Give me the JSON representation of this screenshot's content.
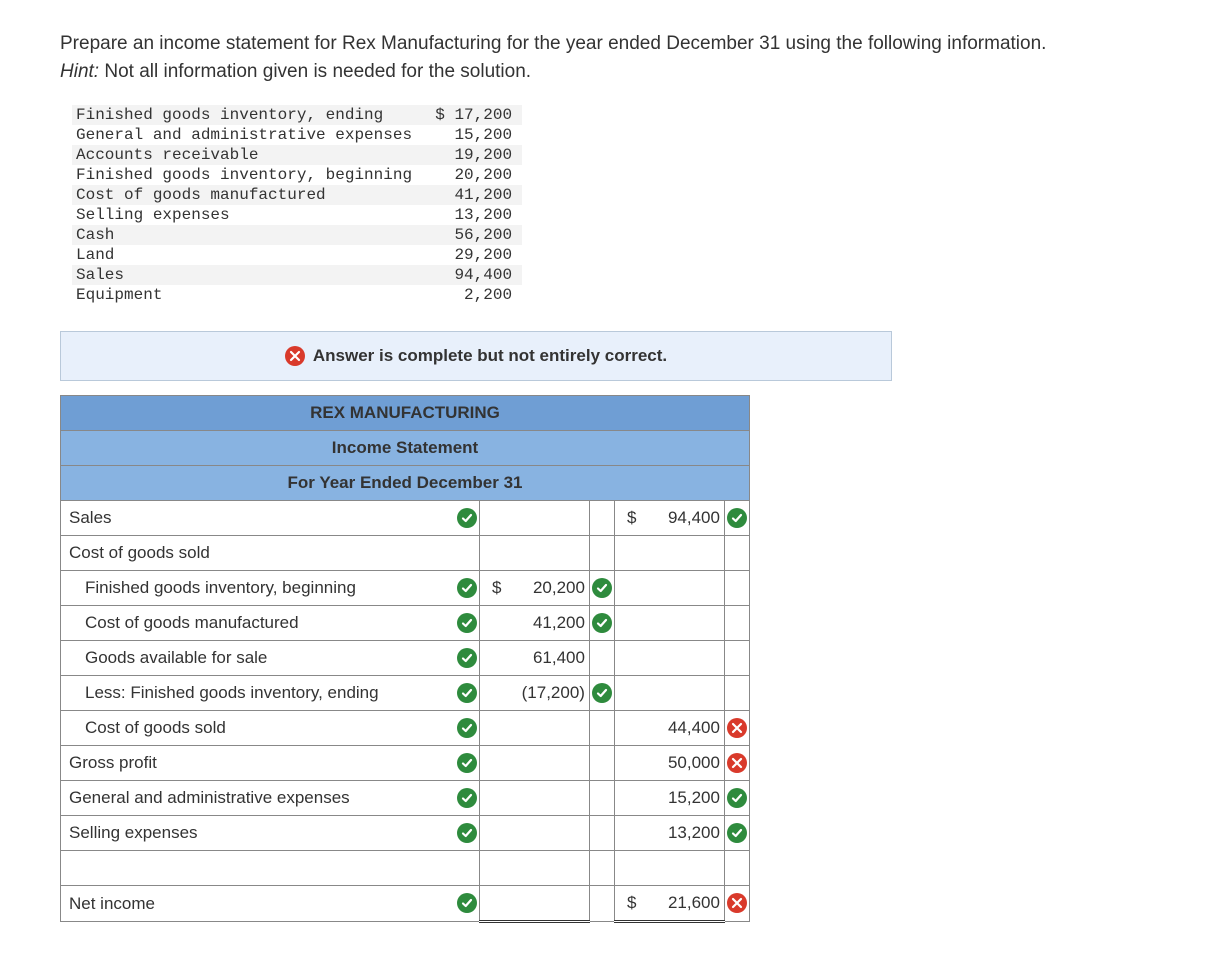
{
  "prompt": {
    "text": "Prepare an income statement for Rex Manufacturing for the year ended December 31 using the following information.",
    "hint_label": "Hint:",
    "hint_text": "Not all information given is needed for the solution."
  },
  "info": {
    "rows": [
      {
        "label": "Finished goods inventory, ending",
        "value": "$ 17,200"
      },
      {
        "label": "General and administrative expenses",
        "value": "15,200"
      },
      {
        "label": "Accounts receivable",
        "value": "19,200"
      },
      {
        "label": "Finished goods inventory, beginning",
        "value": "20,200"
      },
      {
        "label": "Cost of goods manufactured",
        "value": "41,200"
      },
      {
        "label": "Selling expenses",
        "value": "13,200"
      },
      {
        "label": "Cash",
        "value": "56,200"
      },
      {
        "label": "Land",
        "value": "29,200"
      },
      {
        "label": "Sales",
        "value": "94,400"
      },
      {
        "label": "Equipment",
        "value": "2,200"
      }
    ]
  },
  "feedback": "Answer is complete but not entirely correct.",
  "statement": {
    "title": "REX MANUFACTURING",
    "subtitle": "Income Statement",
    "period": "For Year Ended December 31",
    "rows": [
      {
        "label": "Sales",
        "indent": false,
        "label_mark": "check",
        "c1": {},
        "c2": {
          "dollar": true,
          "value": "94,400",
          "mark": "check"
        }
      },
      {
        "label": "Cost of goods sold",
        "indent": false,
        "label_mark": null,
        "c1": {},
        "c2": {}
      },
      {
        "label": "Finished goods inventory, beginning",
        "indent": true,
        "label_mark": "check",
        "c1": {
          "dollar": true,
          "value": "20,200",
          "mark": "check"
        },
        "c2": {}
      },
      {
        "label": "Cost of goods manufactured",
        "indent": true,
        "label_mark": "check",
        "c1": {
          "value": "41,200",
          "mark": "check"
        },
        "c2": {}
      },
      {
        "label": "Goods available for sale",
        "indent": true,
        "label_mark": "check",
        "c1": {
          "value": "61,400"
        },
        "c2": {}
      },
      {
        "label": "Less: Finished goods inventory, ending",
        "indent": true,
        "label_mark": "check",
        "c1": {
          "value": "(17,200)",
          "mark": "check"
        },
        "c2": {}
      },
      {
        "label": "Cost of goods sold",
        "indent": true,
        "label_mark": "check",
        "c1": {},
        "c2": {
          "value": "44,400",
          "mark": "cross"
        }
      },
      {
        "label": "Gross profit",
        "indent": false,
        "label_mark": "check",
        "c1": {},
        "c2": {
          "value": "50,000",
          "mark": "cross"
        }
      },
      {
        "label": "General and administrative expenses",
        "indent": false,
        "label_mark": "check",
        "c1": {},
        "c2": {
          "value": "15,200",
          "mark": "check"
        }
      },
      {
        "label": "Selling expenses",
        "indent": false,
        "label_mark": "check",
        "c1": {},
        "c2": {
          "value": "13,200",
          "mark": "check"
        }
      },
      {
        "label": "",
        "indent": false,
        "label_mark": null,
        "c1": {},
        "c2": {}
      },
      {
        "label": "Net income",
        "indent": false,
        "label_mark": "check",
        "c1": {},
        "c2": {
          "dollar": true,
          "value": "21,600",
          "mark": "cross",
          "double": true
        }
      }
    ]
  }
}
